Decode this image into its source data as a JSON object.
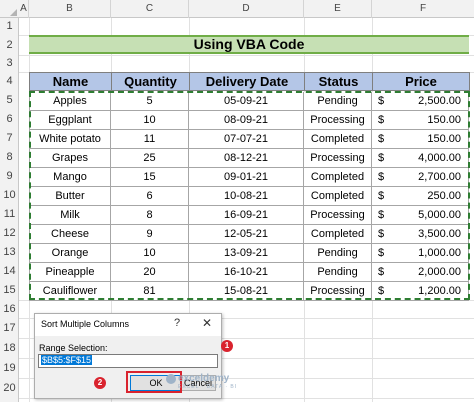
{
  "columns": [
    "A",
    "B",
    "C",
    "D",
    "E",
    "F"
  ],
  "rows": [
    "1",
    "2",
    "3",
    "4",
    "5",
    "6",
    "7",
    "8",
    "9",
    "10",
    "11",
    "12",
    "13",
    "14",
    "15",
    "16",
    "17",
    "18",
    "19",
    "20"
  ],
  "title": "Using VBA Code",
  "table": {
    "headers": [
      "Name",
      "Quantity",
      "Delivery Date",
      "Status",
      "Price"
    ],
    "currency": "$",
    "rows": [
      [
        "Apples",
        "5",
        "05-09-21",
        "Pending",
        "2,500.00"
      ],
      [
        "Eggplant",
        "10",
        "08-09-21",
        "Processing",
        "150.00"
      ],
      [
        "White potato",
        "11",
        "07-07-21",
        "Completed",
        "150.00"
      ],
      [
        "Grapes",
        "25",
        "08-12-21",
        "Processing",
        "4,000.00"
      ],
      [
        "Mango",
        "15",
        "09-01-21",
        "Completed",
        "2,700.00"
      ],
      [
        "Butter",
        "6",
        "10-08-21",
        "Completed",
        "250.00"
      ],
      [
        "Milk",
        "8",
        "16-09-21",
        "Processing",
        "5,000.00"
      ],
      [
        "Cheese",
        "9",
        "12-05-21",
        "Completed",
        "3,500.00"
      ],
      [
        "Orange",
        "10",
        "13-09-21",
        "Pending",
        "1,000.00"
      ],
      [
        "Pineapple",
        "20",
        "16-10-21",
        "Pending",
        "2,000.00"
      ],
      [
        "Cauliflower",
        "81",
        "15-08-21",
        "Processing",
        "1,200.00"
      ]
    ]
  },
  "dialog": {
    "title": "Sort Multiple Columns",
    "help": "?",
    "close": "✕",
    "range_label": "Range Selection:",
    "range_value": "$B$5:$F$15",
    "ok_label": "OK",
    "cancel_label": "Cancel"
  },
  "badges": {
    "one": "1",
    "two": "2"
  },
  "watermark": {
    "name": "exceldemy",
    "sub": "EXCEL · DATA · BI"
  },
  "colors": {
    "title_fill": "#c6e0b4",
    "header_fill": "#b4c6e7",
    "marquee": "#2e7d32",
    "highlight": "#d9232e"
  }
}
